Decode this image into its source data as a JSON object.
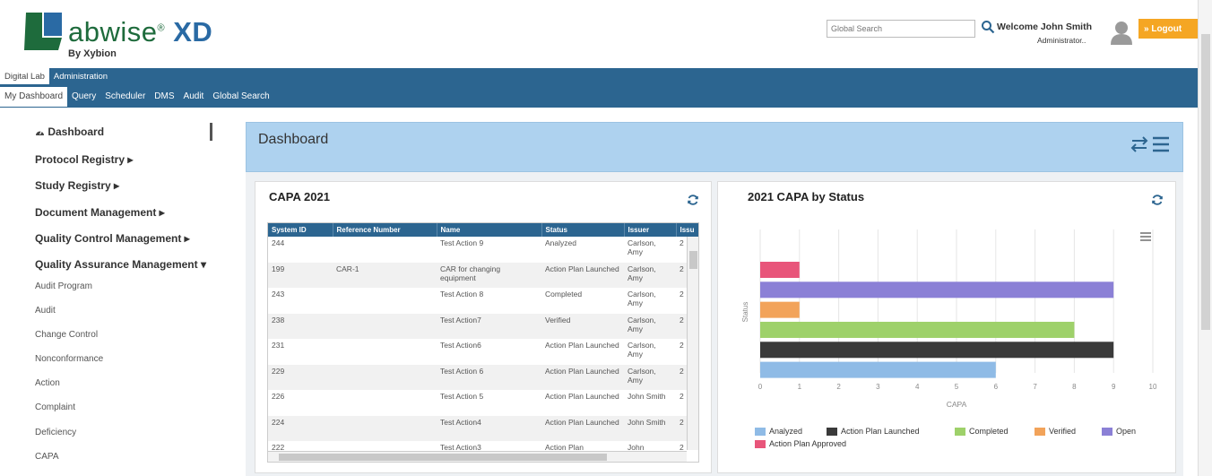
{
  "app": {
    "logo_word": "abwise",
    "logo_reg": "®",
    "logo_suffix": "XD",
    "byline": "By Xybion"
  },
  "header": {
    "search_placeholder": "Global Search",
    "welcome": "Welcome John Smith",
    "role": "Administrator..",
    "logout_label": "» Logout"
  },
  "nav": {
    "top_tabs": [
      "Digital Lab",
      "Administration"
    ],
    "bottom_tabs": [
      "My Dashboard",
      "Query",
      "Scheduler",
      "DMS",
      "Audit",
      "Global Search"
    ]
  },
  "sidebar": {
    "dashboard": "Dashboard",
    "protocol": "Protocol Registry ▸",
    "study": "Study Registry ▸",
    "document": "Document Management ▸",
    "qc": "Quality Control Management ▸",
    "qa": "Quality Assurance Management ▾",
    "subitems": [
      "Audit Program",
      "Audit",
      "Change Control",
      "Nonconformance",
      "Action",
      "Complaint",
      "Deficiency",
      "CAPA"
    ]
  },
  "dashboard": {
    "title": "Dashboard"
  },
  "capa_card": {
    "title": "CAPA  2021",
    "columns": [
      "System ID",
      "Reference Number",
      "Name",
      "Status",
      "Issuer",
      "Issu"
    ],
    "rows": [
      [
        "244",
        "",
        "Test Action 9",
        "Analyzed",
        "Carlson, Amy",
        "2"
      ],
      [
        "199",
        "CAR-1",
        "CAR for changing equipment",
        "Action Plan Launched",
        "Carlson, Amy",
        "2"
      ],
      [
        "243",
        "",
        "Test Action 8",
        "Completed",
        "Carlson, Amy",
        "2"
      ],
      [
        "238",
        "",
        "Test Action7",
        "Verified",
        "Carlson, Amy",
        "2"
      ],
      [
        "231",
        "",
        "Test Action6",
        "Action Plan Launched",
        "Carlson, Amy",
        "2"
      ],
      [
        "229",
        "",
        "Test Action 6",
        "Action Plan Launched",
        "Carlson, Amy",
        "2"
      ],
      [
        "226",
        "",
        "Test Action 5",
        "Action Plan Launched",
        "John Smith",
        "2"
      ],
      [
        "224",
        "",
        "Test Action4",
        "Action Plan Launched",
        "John Smith",
        "2"
      ],
      [
        "222",
        "",
        "Test Action3",
        "Action Plan",
        "John",
        "2"
      ]
    ]
  },
  "status_card": {
    "title": "2021 CAPA by Status"
  },
  "chart_data": {
    "type": "bar",
    "orientation": "horizontal",
    "title": "2021 CAPA by Status",
    "xlabel": "CAPA",
    "ylabel": "Status",
    "xlim": [
      0,
      10
    ],
    "x_ticks": [
      "0",
      "1",
      "2",
      "3",
      "4",
      "5",
      "6",
      "7",
      "8",
      "9",
      "10"
    ],
    "series": [
      {
        "name": "Action Plan Approved",
        "value": 1,
        "color": "#e8557a"
      },
      {
        "name": "Open",
        "value": 9,
        "color": "#8b80d6"
      },
      {
        "name": "Verified",
        "value": 1,
        "color": "#f2a35a"
      },
      {
        "name": "Completed",
        "value": 8,
        "color": "#9ed16a"
      },
      {
        "name": "Action Plan Launched",
        "value": 9,
        "color": "#3a3a3a"
      },
      {
        "name": "Analyzed",
        "value": 6,
        "color": "#8fbbe6"
      }
    ],
    "legend": [
      "Analyzed",
      "Action Plan Launched",
      "Completed",
      "Verified",
      "Open",
      "Action Plan Approved"
    ],
    "legend_placement": "bottom",
    "grid": true
  }
}
